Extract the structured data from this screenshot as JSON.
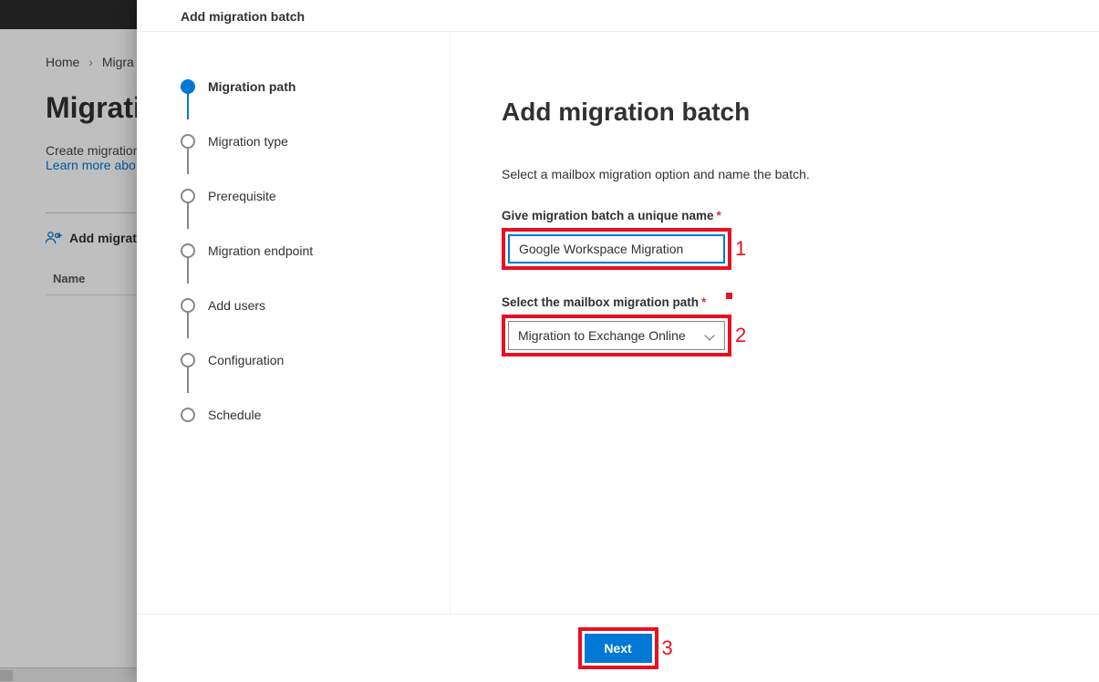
{
  "background": {
    "breadcrumb_home": "Home",
    "breadcrumb_current": "Migra",
    "page_title": "Migrati",
    "desc": "Create migration",
    "learn_link": "Learn more abo",
    "toolbar_add": "Add migrat",
    "col_name": "Name"
  },
  "panel": {
    "header": "Add migration batch",
    "steps": [
      {
        "label": "Migration path",
        "active": true
      },
      {
        "label": "Migration type",
        "active": false
      },
      {
        "label": "Prerequisite",
        "active": false
      },
      {
        "label": "Migration endpoint",
        "active": false
      },
      {
        "label": "Add users",
        "active": false
      },
      {
        "label": "Configuration",
        "active": false
      },
      {
        "label": "Schedule",
        "active": false
      }
    ],
    "title": "Add migration batch",
    "helper": "Select a mailbox migration option and name the batch.",
    "name_label": "Give migration batch a unique name",
    "name_value": "Google Workspace Migration",
    "path_label": "Select the mailbox migration path",
    "path_value": "Migration to Exchange Online",
    "next_label": "Next",
    "annotations": {
      "name": "1",
      "path": "2",
      "next": "3"
    }
  }
}
